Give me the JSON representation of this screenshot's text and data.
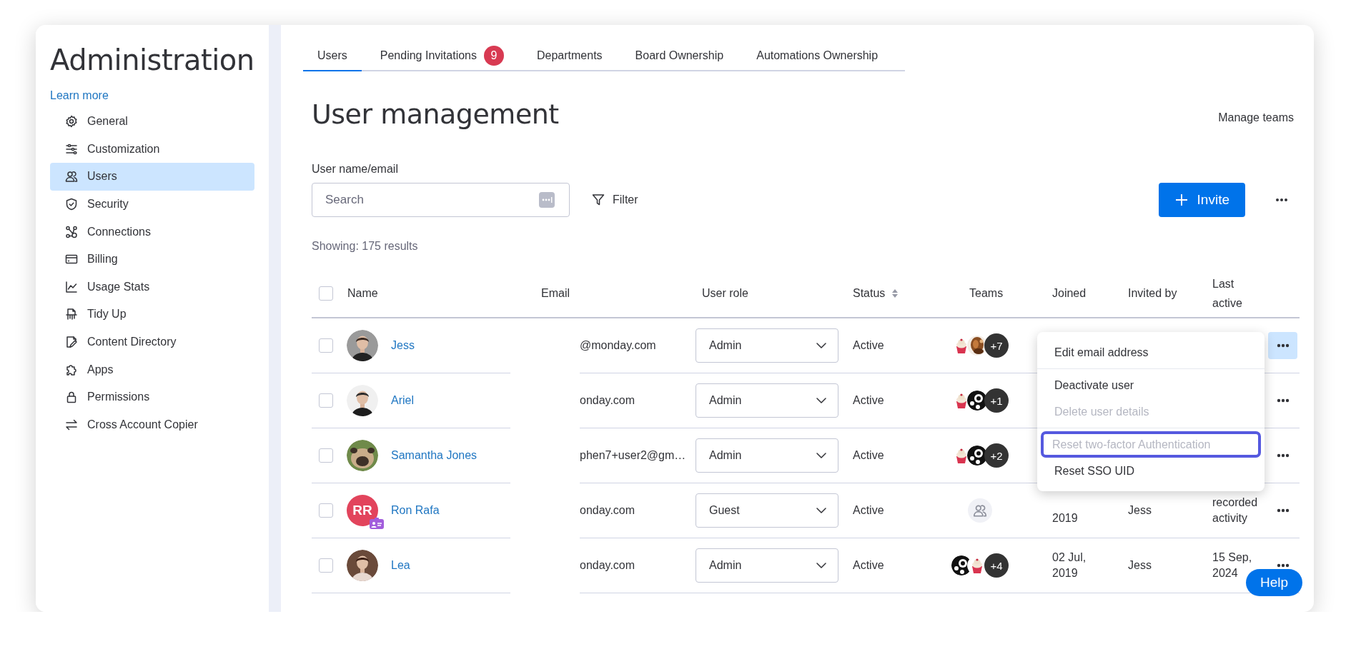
{
  "sidebar": {
    "title": "Administration",
    "learn_more": "Learn more",
    "items": [
      {
        "label": "General",
        "selected": false
      },
      {
        "label": "Customization",
        "selected": false
      },
      {
        "label": "Users",
        "selected": true
      },
      {
        "label": "Security",
        "selected": false
      },
      {
        "label": "Connections",
        "selected": false
      },
      {
        "label": "Billing",
        "selected": false
      },
      {
        "label": "Usage Stats",
        "selected": false
      },
      {
        "label": "Tidy Up",
        "selected": false
      },
      {
        "label": "Content Directory",
        "selected": false
      },
      {
        "label": "Apps",
        "selected": false
      },
      {
        "label": "Permissions",
        "selected": false
      },
      {
        "label": "Cross Account Copier",
        "selected": false
      }
    ]
  },
  "tabs": [
    {
      "label": "Users",
      "selected": true
    },
    {
      "label": "Pending Invitations",
      "selected": false,
      "badge": "9"
    },
    {
      "label": "Departments",
      "selected": false
    },
    {
      "label": "Board Ownership",
      "selected": false
    },
    {
      "label": "Automations Ownership",
      "selected": false
    }
  ],
  "page_title": "User management",
  "manage_teams": "Manage teams",
  "search": {
    "label": "User name/email",
    "placeholder": "Search"
  },
  "filter": "Filter",
  "invite": "Invite",
  "results": "Showing: 175 results",
  "table": {
    "select_all": {
      "checked": false
    },
    "columns": [
      {
        "label": "Name"
      },
      {
        "label": "Email"
      },
      {
        "label": "User role"
      },
      {
        "label": "Status",
        "sortable": true
      },
      {
        "label": "Teams"
      },
      {
        "label": "Joined"
      },
      {
        "label": "Invited by"
      },
      {
        "label": "Last active"
      }
    ],
    "rows": [
      {
        "checked": false,
        "name": "Jess",
        "email": "@monday.com",
        "role": "Admin",
        "status": "Active",
        "teams_more": "+7",
        "menu_open": true
      },
      {
        "checked": false,
        "name": "Ariel",
        "email": "onday.com",
        "role": "Admin",
        "status": "Active",
        "teams_more": "+1",
        "menu_open": false
      },
      {
        "checked": false,
        "name": "Samantha Jones",
        "email": "phen7+user2@gm…",
        "role": "Admin",
        "status": "Active",
        "teams_more": "+2",
        "menu_open": false
      },
      {
        "checked": false,
        "avatar": {
          "kind": "initials",
          "initials": "RR",
          "color": "#e2445c",
          "guest": true
        },
        "name": "Ron Rafa",
        "email": "onday.com",
        "role": "Guest",
        "status": "Active",
        "teams": [
          {
            "kind": "placeholder"
          }
        ],
        "joined": "2019",
        "invited_by": "Jess",
        "last_active": "recorded activity",
        "menu_open": false
      },
      {
        "checked": false,
        "name": "Lea",
        "email": "onday.com",
        "role": "Admin",
        "status": "Active",
        "teams_more": "+4",
        "joined": "02 Jul, 2019",
        "invited_by": "Jess",
        "last_active": "15 Sep, 2024",
        "menu_open": false
      }
    ]
  },
  "row_menu": {
    "groups": [
      [
        {
          "label": "Edit email address",
          "disabled": false,
          "focused": false
        }
      ],
      [
        {
          "label": "Deactivate user",
          "disabled": false,
          "focused": false
        },
        {
          "label": "Delete user details",
          "disabled": true,
          "focused": false
        }
      ],
      [
        {
          "label": "Reset two-factor Authentication",
          "disabled": true,
          "focused": true
        },
        {
          "label": "Reset SSO UID",
          "disabled": false,
          "focused": false
        }
      ]
    ]
  },
  "help": "Help"
}
